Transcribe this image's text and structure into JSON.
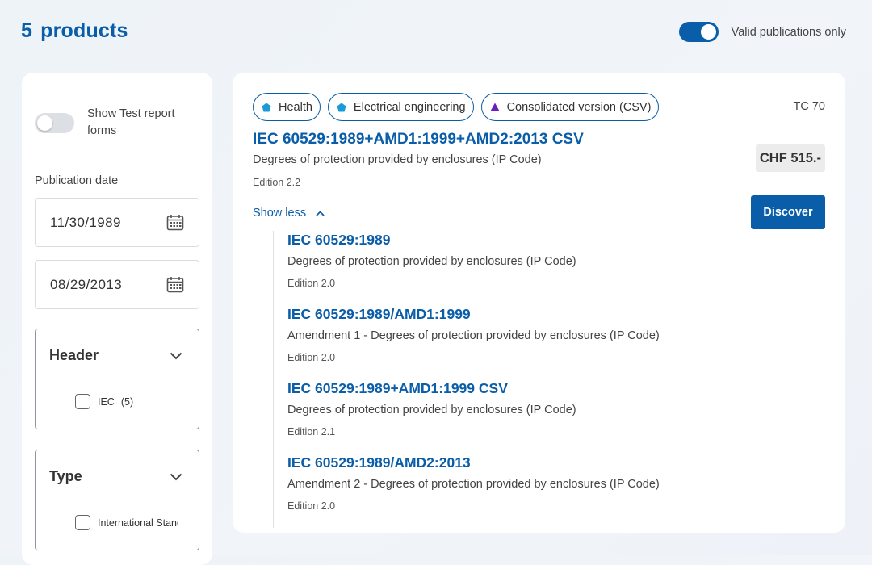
{
  "header": {
    "count": "5",
    "products_label": "products",
    "valid_toggle": {
      "label": "Valid publications only",
      "state": "on"
    }
  },
  "sidebar": {
    "test_report": {
      "label": "Show Test report forms",
      "state": "off"
    },
    "publication_date": {
      "label": "Publication date",
      "from": "11/30/1989",
      "to": "08/29/2013"
    },
    "facets": [
      {
        "title": "Header",
        "option": {
          "label": "IEC",
          "count": "(5)"
        }
      },
      {
        "title": "Type",
        "option": {
          "label": "International Standard",
          "count": ""
        }
      }
    ]
  },
  "product": {
    "tags": [
      {
        "label": "Health",
        "icon": "pentagon-icon",
        "color": "#1a9ad6"
      },
      {
        "label": "Electrical engineering",
        "icon": "pentagon-icon",
        "color": "#1a9ad6"
      },
      {
        "label": "Consolidated version (CSV)",
        "icon": "triangle-icon",
        "color": "#6a1fc0"
      }
    ],
    "tc": "TC 70",
    "title": "IEC 60529:1989+AMD1:1999+AMD2:2013 CSV",
    "description": "Degrees of protection provided by enclosures (IP Code)",
    "edition": "Edition 2.2",
    "price": "CHF 515.-",
    "discover_label": "Discover",
    "show_less_label": "Show less",
    "sub_items": [
      {
        "title": "IEC 60529:1989",
        "description": "Degrees of protection provided by enclosures (IP Code)",
        "edition": "Edition 2.0"
      },
      {
        "title": "IEC 60529:1989/AMD1:1999",
        "description": "Amendment 1 - Degrees of protection provided by enclosures (IP Code)",
        "edition": "Edition 2.0"
      },
      {
        "title": "IEC 60529:1989+AMD1:1999 CSV",
        "description": "Degrees of protection provided by enclosures (IP Code)",
        "edition": "Edition 2.1"
      },
      {
        "title": "IEC 60529:1989/AMD2:2013",
        "description": "Amendment 2 - Degrees of protection provided by enclosures (IP Code)",
        "edition": "Edition 2.0"
      }
    ]
  },
  "colors": {
    "accent": "#0a5da8",
    "pentagon": "#1a9ad6",
    "triangle": "#6a1fc0"
  }
}
